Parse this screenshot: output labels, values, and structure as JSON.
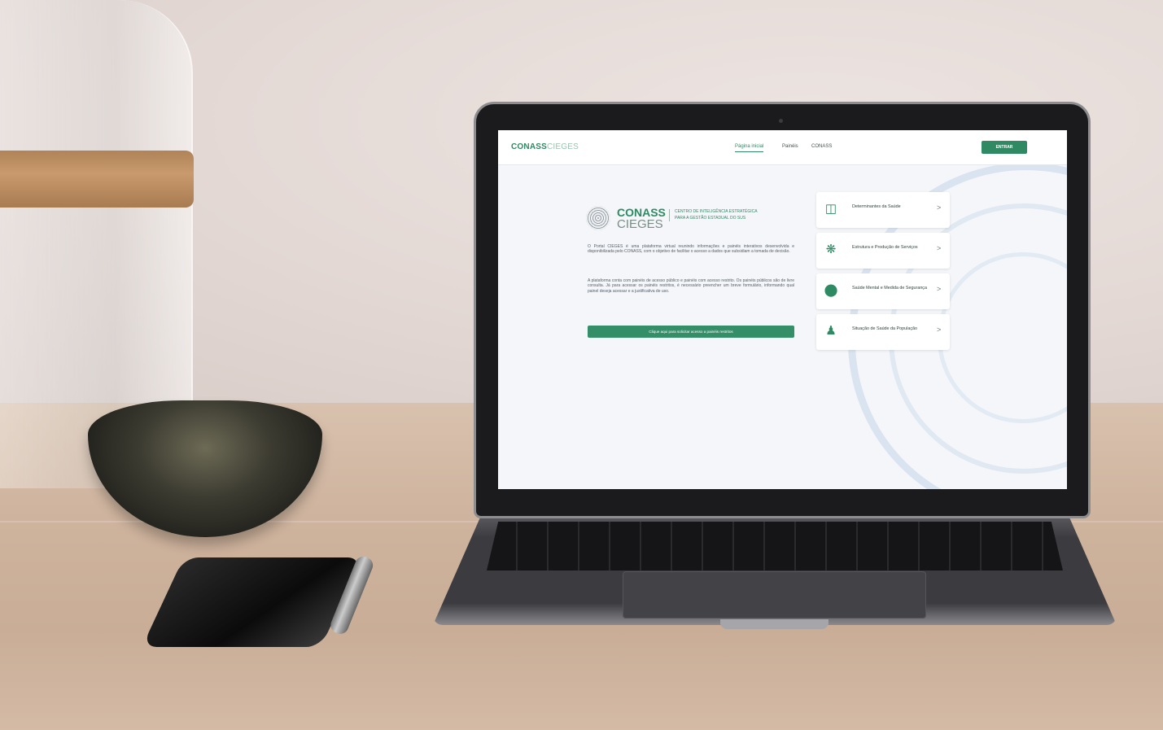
{
  "scene": {
    "colors": {
      "brand_green": "#2d8a63",
      "screen_bg": "#f4f6f9"
    }
  },
  "header": {
    "logo_main": "CONASS",
    "logo_sub": "CIEGES",
    "nav": [
      {
        "label": "Página inicial",
        "active": true
      },
      {
        "label": "Painéis",
        "active": false
      },
      {
        "label": "CONASS",
        "active": false
      }
    ],
    "login_label": "ENTRAR"
  },
  "brand": {
    "name": "CONASS",
    "subname": "CIEGES",
    "tagline": "CENTRO DE INTELIGÊNCIA ESTRATÉGICA PARA A GESTÃO ESTADUAL DO SUS"
  },
  "intro": {
    "paragraph1": "O Portal CIEGES é uma plataforma virtual reunindo informações e painéis interativos desenvolvida e disponibilizada pelo CONASS, com o objetivo de facilitar o acesso a dados que subsidiam a tomada de decisão.",
    "paragraph2": "A plataforma conta com painéis de acesso público e painéis com acesso restrito. Os painéis públicos são de livre consulta. Já para acessar os painéis restritos, é necessário preencher um breve formulário, informando qual painel deseja acessar e a justificativa de uso.",
    "cta_label": "Clique aqui para solicitar acesso a painéis restritos"
  },
  "cards": [
    {
      "label": "Determinantes da Saúde",
      "icon": "clipboard-plus-icon",
      "arrow": ">"
    },
    {
      "label": "Estrutura e Produção de Serviços",
      "icon": "network-icon",
      "arrow": ">"
    },
    {
      "label": "Saúde Mental e Medida de Segurança",
      "icon": "brain-icon",
      "arrow": ">"
    },
    {
      "label": "Situação de Saúde da População",
      "icon": "people-icon",
      "arrow": ">"
    }
  ]
}
